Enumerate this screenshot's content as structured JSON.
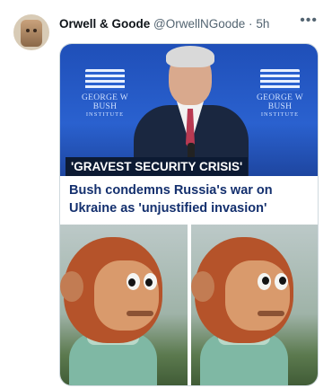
{
  "tweet": {
    "display_name": "Orwell & Goode",
    "handle": "@OrwellNGoode",
    "separator": "·",
    "time": "5h",
    "more_icon": "more-horizontal-icon"
  },
  "media": {
    "photo_logo_left": {
      "line1": "GEORGE W BUSH",
      "line2": "INSTITUTE"
    },
    "photo_logo_right": {
      "line1": "GEORGE W BUSH",
      "line2": "INSTITUTE"
    },
    "caption": "'GRAVEST SECURITY CRISIS'",
    "headline": "Bush condemns Russia's war on Ukraine as 'unjustified invasion'",
    "meme_description_icon": "awkward-puppet-meme-image"
  },
  "colors": {
    "headline_text": "#14306e",
    "caption_bg": "#0c1a33",
    "photo_bg": "#2a61cf",
    "muted_text": "#536471"
  }
}
